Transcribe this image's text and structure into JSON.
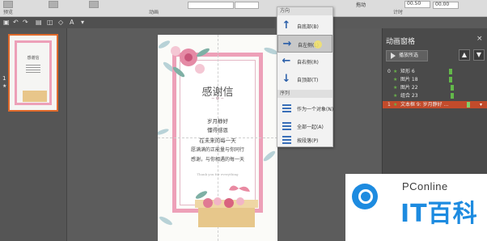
{
  "ribbon": {
    "group_left": "预览",
    "group_animation": "动画",
    "group_timing": "计时",
    "field_value_1": "00.50",
    "field_value_2": "00.00",
    "small_label": "拖动"
  },
  "menu": {
    "direction_header": "方向",
    "direction_items": [
      {
        "icon": "arrow-up-icon",
        "glyph": "↑",
        "label": "自底部(B)"
      },
      {
        "icon": "arrow-right-icon",
        "glyph": "→",
        "label": "自左侧(L)",
        "selected": true
      },
      {
        "icon": "arrow-left-icon",
        "glyph": "←",
        "label": "自右侧(R)"
      },
      {
        "icon": "arrow-down-icon",
        "glyph": "↓",
        "label": "自顶部(T)"
      }
    ],
    "sequence_header": "序列",
    "sequence_items": [
      {
        "icon": "as-one-object-icon",
        "label": "作为一个对象(N)"
      },
      {
        "icon": "all-at-once-icon",
        "label": "全部一起(A)"
      },
      {
        "icon": "by-paragraph-icon",
        "label": "按段落(P)"
      }
    ]
  },
  "thumbnail": {
    "slide_number": "1",
    "star": "★"
  },
  "slide": {
    "title": "感谢信",
    "poem_lines": [
      "岁月静好",
      "懂得感恩",
      "在未来的每一天",
      "愿满满的正能量与你同行",
      "感谢，与你相遇的每一天"
    ],
    "footer_small": "Thank you for everything"
  },
  "pane": {
    "title": "动画窗格",
    "close_glyph": "×",
    "play_label": "播放所选",
    "up_glyph": "▲",
    "down_glyph": "▼",
    "items": [
      {
        "num": "0",
        "star": "★",
        "label": "矩形 6",
        "selected": false
      },
      {
        "num": "",
        "star": "★",
        "label": "图片 18",
        "selected": false
      },
      {
        "num": "",
        "star": "★",
        "label": "图片 22",
        "selected": false
      },
      {
        "num": "",
        "star": "★",
        "label": "组合 23",
        "selected": false
      },
      {
        "num": "1",
        "star": "★",
        "label": "文本框 9: 岁月静好 …",
        "selected": true
      }
    ]
  },
  "watermark": {
    "en": "PConline",
    "cn": "IT百科"
  },
  "colors": {
    "accent": "#c24b2b",
    "arrow_blue": "#2a5ea8",
    "frame_pink": "#eda0b8",
    "brand_blue": "#1d8be0"
  }
}
